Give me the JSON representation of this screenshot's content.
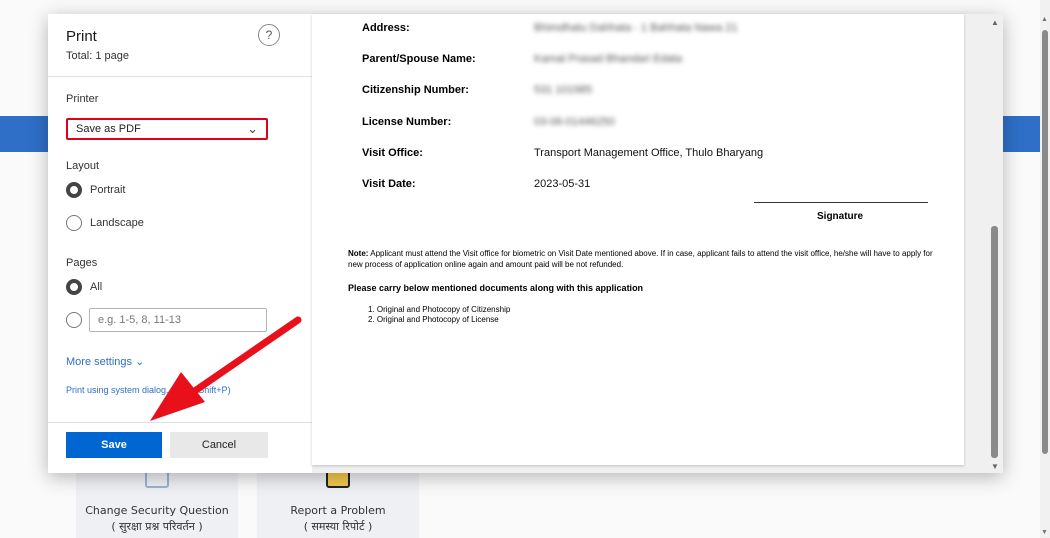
{
  "background": {
    "cards": [
      {
        "title": "Change Security Question",
        "subtitle": "( सुरक्षा प्रश्न परिवर्तन )"
      },
      {
        "title": "Report a Problem",
        "subtitle": "( समस्या रिपोर्ट )"
      }
    ]
  },
  "print_dialog": {
    "title": "Print",
    "total": "Total: 1 page",
    "help_icon": "?",
    "printer_label": "Printer",
    "printer_value": "Save as PDF",
    "layout_label": "Layout",
    "layout_options": [
      "Portrait",
      "Landscape"
    ],
    "layout_selected": "Portrait",
    "pages_label": "Pages",
    "pages_all": "All",
    "pages_placeholder": "e.g. 1-5, 8, 11-13",
    "more_settings": "More settings ⌄",
    "system_dialog": "Print using system dialog... (Ctrl+Shift+P)",
    "save_label": "Save",
    "cancel_label": "Cancel"
  },
  "preview": {
    "fields": [
      {
        "label": "Address:",
        "value": "Bhimdhatu Dahhata - 1 Bahhata Nawa 21"
      },
      {
        "label": "Parent/Spouse Name:",
        "value": "Kamal Prasad Bhandari Edata"
      },
      {
        "label": "Citizenship Number:",
        "value": "531 101985"
      },
      {
        "label": "License Number:",
        "value": "03-06-01446250"
      },
      {
        "label": "Visit Office:",
        "value": "Transport Management Office, Thulo Bharyang"
      },
      {
        "label": "Visit Date:",
        "value": "2023-05-31"
      }
    ],
    "signature": "Signature",
    "note_prefix": "Note:",
    "note_text": " Applicant must attend the Visit office for biometric on Visit Date mentioned above. If in case, applicant fails to attend the visit office, he/she will have to apply for new process of application online again and amount paid will be not refunded.",
    "carry_heading": "Please carry below mentioned documents along with this application",
    "documents": [
      "1. Original and Photocopy of Citizenship",
      "2. Original and Photocopy of License"
    ]
  },
  "colors": {
    "accent": "#0066d1",
    "highlight": "#e0001b",
    "banner": "#2f6fc7"
  }
}
